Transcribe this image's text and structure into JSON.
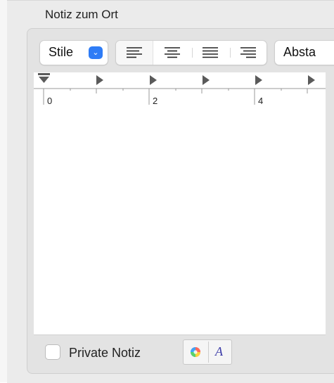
{
  "section": {
    "title": "Notiz zum Ort"
  },
  "toolbar": {
    "style_label": "Stile",
    "style_arrow": "⌄",
    "align_options": [
      "align-left",
      "align-center",
      "align-justify",
      "align-right"
    ],
    "align_selected": "align-left",
    "spacing_label": "Absta"
  },
  "ruler": {
    "labels": [
      "0",
      "2",
      "4"
    ]
  },
  "editor": {
    "text": ""
  },
  "footer": {
    "private_label": "Private Notiz",
    "private_checked": false,
    "font_button_glyph": "A"
  },
  "colors": {
    "accent": "#2e7cf6",
    "pane_bg": "#ebebeb"
  }
}
